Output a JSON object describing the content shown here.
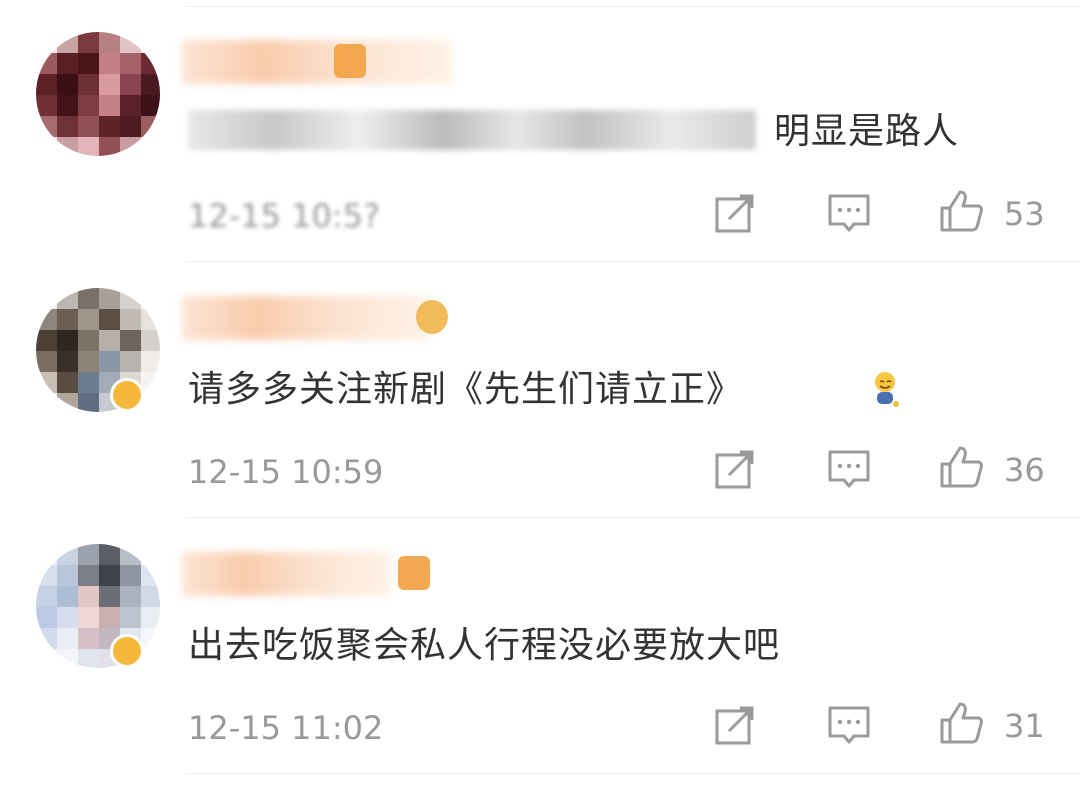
{
  "comments": [
    {
      "text": "明显是路人",
      "time": "12-15 10:5?",
      "likes": "53",
      "badge": false
    },
    {
      "text": "请多多关注新剧《先生们请立正》",
      "time": "12-15 10:59",
      "likes": "36",
      "badge": true,
      "emoji": "sweat-smile-emoji"
    },
    {
      "text": "出去吃饭聚会私人行程没必要放大吧",
      "time": "12-15 11:02",
      "likes": "31",
      "badge": true
    }
  ],
  "icons": {
    "share": "share-icon",
    "comment": "comment-icon",
    "like": "thumbs-up-icon"
  },
  "colors": {
    "text": "#333333",
    "meta": "#999999",
    "badge": "#f5b83a",
    "divider": "#ececec"
  }
}
